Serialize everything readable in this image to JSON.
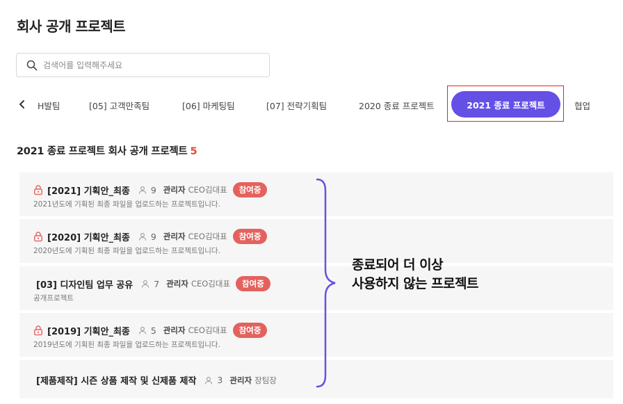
{
  "page": {
    "title": "회사 공개 프로젝트"
  },
  "search": {
    "placeholder": "검색어를 입력해주세요"
  },
  "tabs": [
    {
      "label": "H발팀"
    },
    {
      "label": "[05] 고객만족팀"
    },
    {
      "label": "[06] 마케팅팀"
    },
    {
      "label": "[07] 전략기획팀"
    },
    {
      "label": "2020 종료 프로젝트"
    },
    {
      "label": "2021 종료 프로젝트",
      "active": true
    },
    {
      "label": "협업"
    }
  ],
  "section": {
    "title": "2021 종료 프로젝트 회사 공개 프로젝트",
    "count": "5"
  },
  "projects": [
    {
      "name": "[2021] 기획안_최종",
      "members": "9",
      "manager_label": "관리자",
      "manager": "CEO김대표",
      "badge": "참여중",
      "description": "2021년도에 기획된 최종 파일을 업로드하는 프로젝트입니다.",
      "locked": true
    },
    {
      "name": "[2020] 기획안_최종",
      "members": "9",
      "manager_label": "관리자",
      "manager": "CEO김대표",
      "badge": "참여중",
      "description": "2020년도에 기획된 최종 파일을 업로드하는 프로젝트입니다.",
      "locked": true
    },
    {
      "name": "[03] 디자인팀 업무 공유",
      "members": "7",
      "manager_label": "관리자",
      "manager": "CEO김대표",
      "badge": "참여중",
      "description": "공개프로젝트",
      "locked": false
    },
    {
      "name": "[2019] 기획안_최종",
      "members": "5",
      "manager_label": "관리자",
      "manager": "CEO김대표",
      "badge": "참여중",
      "description": "2019년도에 기획된 최종 파일을 업로드하는 프로젝트입니다.",
      "locked": true
    },
    {
      "name": "[제품제작] 시즌 상품 제작 및 신제품 제작",
      "members": "3",
      "manager_label": "관리자",
      "manager": "장팀장",
      "locked": false
    }
  ],
  "annotation": {
    "line1": "종료되어 더 이상",
    "line2": "사용하지 않는 프로젝트"
  },
  "colors": {
    "accent": "#6550e6",
    "badge": "#e4625e",
    "highlight_frame": "#e0242b",
    "brace": "#6a4fe0",
    "count": "#e24b3a"
  },
  "icons": {
    "search": "search-icon",
    "prev": "chevron-left-icon",
    "lock": "lock-icon",
    "member": "person-icon"
  }
}
